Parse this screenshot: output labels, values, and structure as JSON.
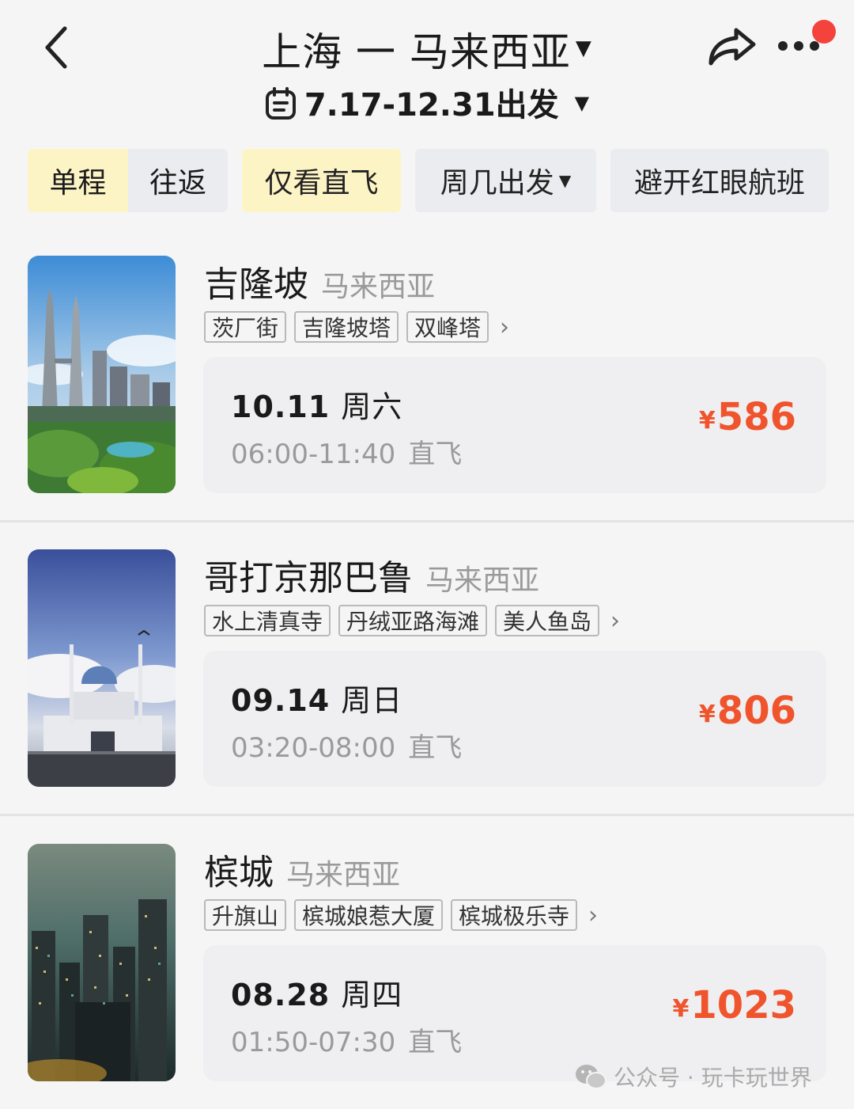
{
  "header": {
    "route": "上海 一 马来西亚",
    "date_range": "7.17-12.31出发"
  },
  "filters": {
    "one_way": "单程",
    "round_trip": "往返",
    "direct_only": "仅看直飞",
    "weekday": "周几出发",
    "avoid_redeye": "避开红眼航班"
  },
  "destinations": [
    {
      "city": "吉隆坡",
      "country": "马来西亚",
      "tags": [
        "茨厂街",
        "吉隆坡塔",
        "双峰塔"
      ],
      "date": "10.11",
      "weekday": "周六",
      "time": "06:00-11:40",
      "flight_type": "直飞",
      "currency": "¥",
      "price": "586"
    },
    {
      "city": "哥打京那巴鲁",
      "country": "马来西亚",
      "tags": [
        "水上清真寺",
        "丹绒亚路海滩",
        "美人鱼岛"
      ],
      "date": "09.14",
      "weekday": "周日",
      "time": "03:20-08:00",
      "flight_type": "直飞",
      "currency": "¥",
      "price": "806"
    },
    {
      "city": "槟城",
      "country": "马来西亚",
      "tags": [
        "升旗山",
        "槟城娘惹大厦",
        "槟城极乐寺"
      ],
      "date": "08.28",
      "weekday": "周四",
      "time": "01:50-07:30",
      "flight_type": "直飞",
      "currency": "¥",
      "price": "1023"
    }
  ],
  "watermark": "公众号 · 玩卡玩世界",
  "colors": {
    "price": "#f0542d",
    "active_filter": "#fdf4c6",
    "filter_bg": "#eaecef",
    "notification_dot": "#f4433c"
  },
  "icons": [
    "back-arrow-icon",
    "calendar-icon",
    "share-icon",
    "more-icon",
    "chevron-right-icon",
    "wechat-icon"
  ]
}
